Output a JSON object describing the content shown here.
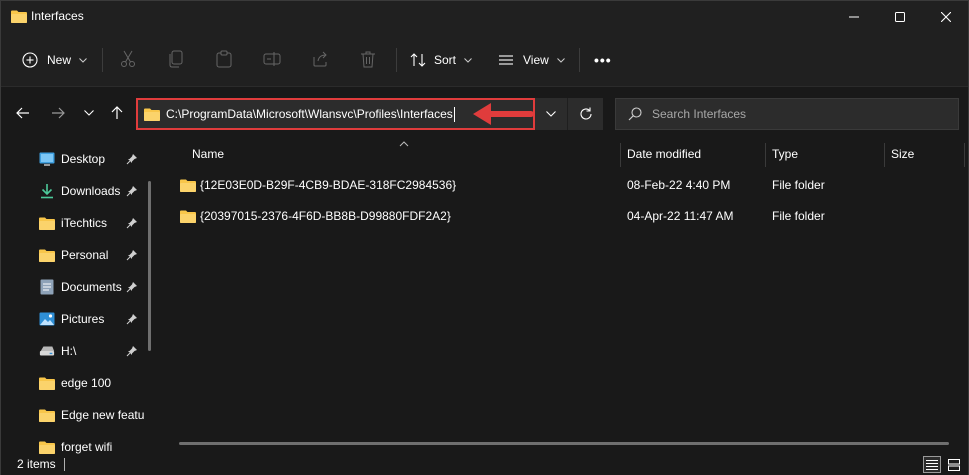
{
  "window": {
    "title": "Interfaces"
  },
  "toolbar": {
    "new_label": "New",
    "sort_label": "Sort",
    "view_label": "View",
    "more_label": "•••"
  },
  "address": {
    "path": "C:\\ProgramData\\Microsoft\\Wlansvc\\Profiles\\Interfaces"
  },
  "search": {
    "placeholder": "Search Interfaces"
  },
  "sidebar": {
    "items": [
      {
        "label": "Desktop",
        "icon": "desktop-icon",
        "pinned": true
      },
      {
        "label": "Downloads",
        "icon": "download-icon",
        "pinned": true
      },
      {
        "label": "iTechtics",
        "icon": "folder-icon",
        "pinned": true
      },
      {
        "label": "Personal",
        "icon": "folder-icon",
        "pinned": true
      },
      {
        "label": "Documents",
        "icon": "document-icon",
        "pinned": true
      },
      {
        "label": "Pictures",
        "icon": "pictures-icon",
        "pinned": true
      },
      {
        "label": "H:\\",
        "icon": "drive-icon",
        "pinned": true
      },
      {
        "label": "edge 100",
        "icon": "folder-icon",
        "pinned": false
      },
      {
        "label": "Edge new featu",
        "icon": "folder-icon",
        "pinned": false
      },
      {
        "label": "forget wifi",
        "icon": "folder-icon",
        "pinned": false
      }
    ]
  },
  "columns": {
    "name": "Name",
    "date_modified": "Date modified",
    "type": "Type",
    "size": "Size"
  },
  "files": [
    {
      "name": "{12E03E0D-B29F-4CB9-BDAE-318FC2984536}",
      "date_modified": "08-Feb-22 4:40 PM",
      "type": "File folder",
      "size": ""
    },
    {
      "name": "{20397015-2376-4F6D-BB8B-D99880FDF2A2}",
      "date_modified": "04-Apr-22 11:47 AM",
      "type": "File folder",
      "size": ""
    }
  ],
  "status": {
    "item_count": "2 items"
  },
  "colors": {
    "folder_yellow": "#f8c64a",
    "highlight_red": "#e03c3c",
    "background": "#191919"
  }
}
